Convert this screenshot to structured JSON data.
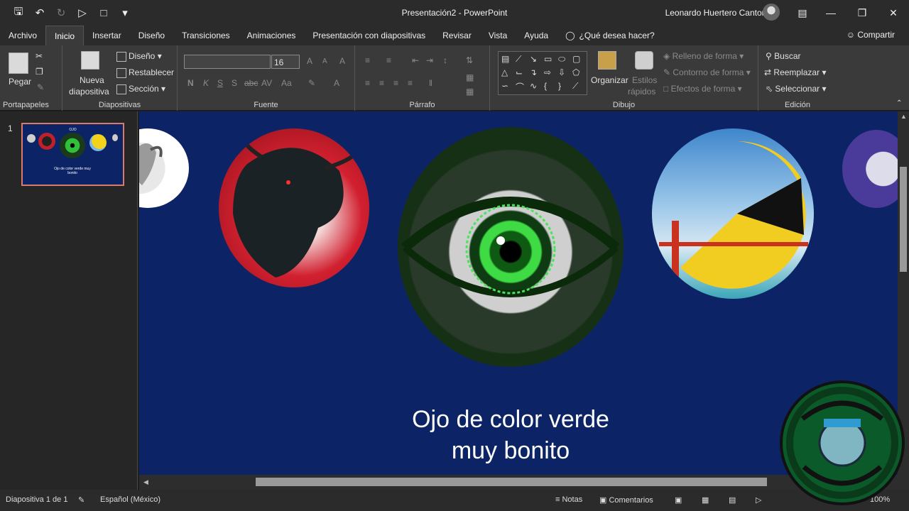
{
  "window": {
    "title": "Presentación2 - PowerPoint",
    "user": "Leonardo Huertero Cantoran"
  },
  "tabs": [
    "Archivo",
    "Inicio",
    "Insertar",
    "Diseño",
    "Transiciones",
    "Animaciones",
    "Presentación con diapositivas",
    "Revisar",
    "Vista",
    "Ayuda"
  ],
  "tellme": "¿Qué desea hacer?",
  "share": "Compartir",
  "ribbon": {
    "portapapeles": {
      "label": "Portapapeles",
      "paste": "Pegar"
    },
    "diapositivas": {
      "label": "Diapositivas",
      "new_line1": "Nueva",
      "new_line2": "diapositiva",
      "layout": "Diseño",
      "reset": "Restablecer",
      "section": "Sección"
    },
    "fuente": {
      "label": "Fuente",
      "size": "16",
      "bold": "N",
      "italic": "K",
      "underline": "S",
      "shadow": "S",
      "strike": "abc",
      "spacing": "AV",
      "case": "Aa",
      "grow": "A",
      "shrink": "A",
      "clear": "A",
      "color": "A"
    },
    "parrafo": {
      "label": "Párrafo"
    },
    "dibujo": {
      "label": "Dibujo",
      "arrange": "Organizar",
      "styles_line1": "Estilos",
      "styles_line2": "rápidos",
      "fill": "Relleno de forma",
      "outline": "Contorno de forma",
      "effects": "Efectos de forma"
    },
    "edicion": {
      "label": "Edición",
      "find": "Buscar",
      "replace": "Reemplazar",
      "select": "Seleccionar"
    }
  },
  "thumbnails": [
    {
      "number": "1",
      "title": "OJO",
      "caption": "Ojo de color verde muy bonito"
    }
  ],
  "slide": {
    "caption_line1": "Ojo de color verde",
    "caption_line2": "muy bonito"
  },
  "status": {
    "slide_info": "Diapositiva 1 de 1",
    "language": "Español (México)",
    "notes": "Notas",
    "comments": "Comentarios",
    "zoom": "100%"
  },
  "colors": {
    "slide_bg": "#0c2466",
    "thumb_border": "#d97a6b",
    "ribbon_bg": "#3a3a3a",
    "titlebar_bg": "#2b2b2b"
  }
}
